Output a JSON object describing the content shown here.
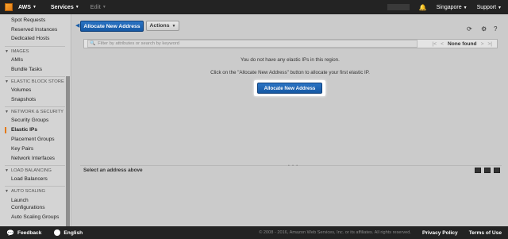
{
  "topnav": {
    "brand": "AWS",
    "services": "Services",
    "edit": "Edit",
    "region": "Singapore",
    "support": "Support"
  },
  "sidebar": {
    "items_top": [
      "Spot Requests",
      "Reserved Instances",
      "Dedicated Hosts"
    ],
    "sections": [
      {
        "heading": "IMAGES",
        "items": [
          "AMIs",
          "Bundle Tasks"
        ]
      },
      {
        "heading": "ELASTIC BLOCK STORE",
        "items": [
          "Volumes",
          "Snapshots"
        ]
      },
      {
        "heading": "NETWORK & SECURITY",
        "items": [
          "Security Groups",
          "Elastic IPs",
          "Placement Groups",
          "Key Pairs",
          "Network Interfaces"
        ]
      },
      {
        "heading": "LOAD BALANCING",
        "items": [
          "Load Balancers"
        ]
      },
      {
        "heading": "AUTO SCALING",
        "items": [
          "Launch Configurations",
          "Auto Scaling Groups"
        ]
      }
    ],
    "active_item": "Elastic IPs"
  },
  "toolbar": {
    "allocate_label": "Allocate New Address",
    "actions_label": "Actions"
  },
  "filter": {
    "placeholder": "Filter by attributes or search by keyword",
    "status": "None found"
  },
  "empty_state": {
    "line1": "You do not have any elastic IPs in this region.",
    "line2": "Click on the \"Allocate New Address\" button to allocate your first elastic IP.",
    "button_label": "Allocate New Address"
  },
  "detail": {
    "select_label": "Select an address above"
  },
  "footer": {
    "feedback": "Feedback",
    "language": "English",
    "copyright": "© 2008 - 2016, Amazon Web Services, Inc. or its affiliates. All rights reserved.",
    "privacy": "Privacy Policy",
    "terms": "Terms of Use"
  },
  "colors": {
    "accent": "#e47911",
    "primary_button": "#1f67b5",
    "nav_bg": "#232323"
  }
}
